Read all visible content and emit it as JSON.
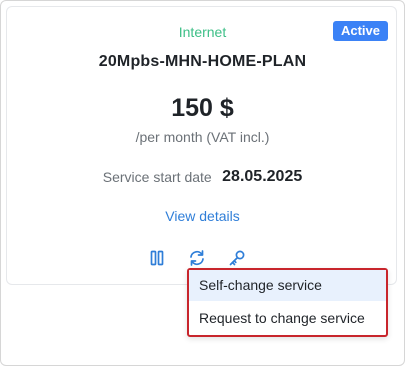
{
  "service": {
    "category": "Internet",
    "status_badge": "Active",
    "plan_name": "20Mpbs-MHN-HOME-PLAN",
    "price": "150 $",
    "price_note": "/per month (VAT incl.)",
    "start_date_label": "Service start date",
    "start_date_value": "28.05.2025",
    "view_details_label": "View details"
  },
  "actions": {
    "icons": [
      "pause-icon",
      "refresh-icon",
      "key-icon"
    ]
  },
  "dropdown": {
    "items": [
      {
        "label": "Self-change service",
        "highlighted": true
      },
      {
        "label": "Request to change service",
        "highlighted": false
      }
    ]
  },
  "colors": {
    "category": "#3dbf87",
    "badge": "#3b82f6",
    "link": "#2f7ed8",
    "dropdown_border": "#c8252c",
    "dropdown_highlight": "#e8f1fd"
  }
}
